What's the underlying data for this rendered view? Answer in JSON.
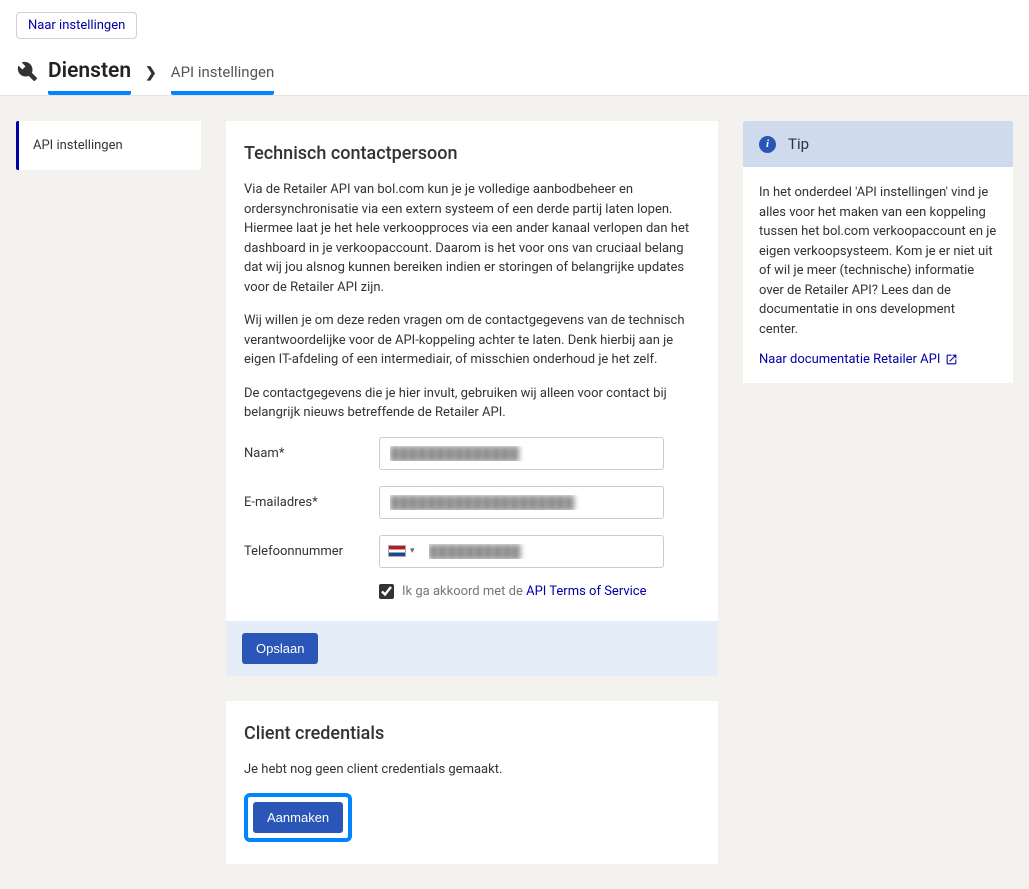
{
  "top_link": "Naar instellingen",
  "breadcrumb": {
    "main": "Diensten",
    "sub": "API instellingen"
  },
  "sidebar": {
    "active_tab": "API instellingen"
  },
  "contact": {
    "title": "Technisch contactpersoon",
    "para1": "Via de Retailer API van bol.com kun je je volledige aanbodbeheer en ordersynchronisatie via een extern systeem of een derde partij laten lopen. Hiermee laat je het hele verkoopproces via een ander kanaal verlopen dan het dashboard in je verkoopaccount. Daarom is het voor ons van cruciaal belang dat wij jou alsnog kunnen bereiken indien er storingen of belangrijke updates voor de Retailer API zijn.",
    "para2": "Wij willen je om deze reden vragen om de contactgegevens van de technisch verantwoordelijke voor de API-koppeling achter te laten. Denk hierbij aan je eigen IT-afdeling of een intermediair, of misschien onderhoud je het zelf.",
    "para3": "De contactgegevens die je hier invult, gebruiken wij alleen voor contact bij belangrijk nieuws betreffende de Retailer API.",
    "labels": {
      "name": "Naam*",
      "email": "E-mailadres*",
      "phone": "Telefoonnummer"
    },
    "values": {
      "name": "██████████████",
      "email": "████████████████████",
      "phone": "██████████"
    },
    "checkbox_prefix": "Ik ga akkoord met de ",
    "checkbox_link": "API Terms of Service",
    "save_label": "Opslaan"
  },
  "credentials": {
    "title": "Client credentials",
    "empty_text": "Je hebt nog geen client credentials gemaakt.",
    "create_label": "Aanmaken"
  },
  "tip": {
    "title": "Tip",
    "body": "In het onderdeel 'API instellingen' vind je alles voor het maken van een koppeling tussen het bol.com verkoopaccount en je eigen verkoopsysteem. Kom je er niet uit of wil je meer (technische) informatie over de Retailer API? Lees dan de documentatie in ons development center.",
    "link": "Naar documentatie Retailer API"
  }
}
